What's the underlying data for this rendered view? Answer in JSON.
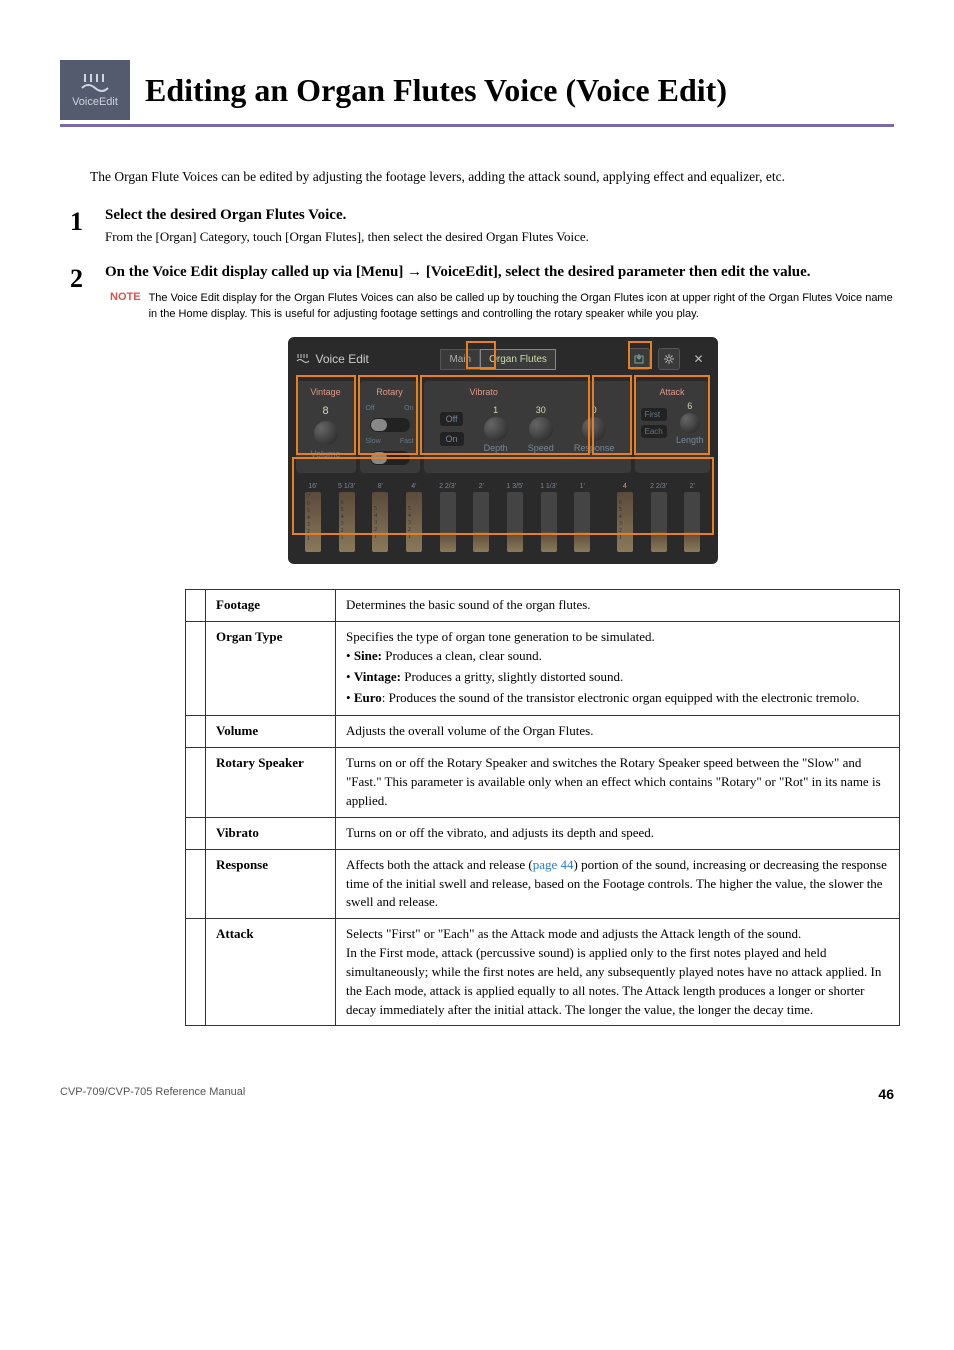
{
  "header": {
    "icon_label": "VoiceEdit",
    "title": "Editing an Organ Flutes Voice (Voice Edit)"
  },
  "intro": "The Organ Flute Voices can be edited by adjusting the footage levers, adding the attack sound, applying effect and equalizer, etc.",
  "steps": [
    {
      "num": "1",
      "title": "Select the desired Organ Flutes Voice.",
      "desc": "From the [Organ] Category, touch [Organ Flutes], then select the desired Organ Flutes Voice."
    },
    {
      "num": "2",
      "title": "On the Voice Edit display called up via [Menu] → [VoiceEdit], select the desired parameter then edit the value.",
      "desc": ""
    }
  ],
  "note": {
    "label": "NOTE",
    "text": "The Voice Edit display for the Organ Flutes Voices can also be called up by touching the Organ Flutes icon at upper right of the Organ Flutes Voice name in the Home display. This is useful for adjusting footage settings and controlling the rotary speaker while you play."
  },
  "screenshot": {
    "header_title": "Voice Edit",
    "tab_main": "Main",
    "tab_voice": "Organ Flutes",
    "panels": {
      "organ_type": {
        "label": "Vintage",
        "value": "8",
        "volume_label": "Volume"
      },
      "rotary": {
        "label": "Rotary",
        "off": "Off",
        "on": "On",
        "slow": "Slow",
        "fast": "Fast"
      },
      "vibrato": {
        "label": "Vibrato",
        "off": "Off",
        "on": "On",
        "depth_label": "Depth",
        "depth_val": "1",
        "speed_label": "Speed",
        "speed_val": "30",
        "response_label": "Response",
        "response_val": "0"
      },
      "attack": {
        "label": "Attack",
        "first": "First",
        "each": "Each",
        "length_label": "Length",
        "length_val": "6",
        "four_val": "4"
      }
    },
    "footage_labels": [
      "16'",
      "5 1/3'",
      "8'",
      "4'",
      "2 2/3'",
      "2'",
      "1 3/5'",
      "1 1/3'",
      "1'",
      "4'",
      "2 2/3'",
      "2'"
    ]
  },
  "table": [
    {
      "label": "Footage",
      "body": "Determines the basic sound of the organ flutes."
    },
    {
      "label": "Organ Type",
      "body_intro": "Specifies the type of organ tone generation to be simulated.",
      "bullets": [
        {
          "strong": "Sine:",
          "rest": " Produces a clean, clear sound."
        },
        {
          "strong": "Vintage:",
          "rest": " Produces a gritty, slightly distorted sound."
        },
        {
          "strong": "Euro",
          "rest": ": Produces the sound of the transistor electronic organ equipped with the electronic tremolo."
        }
      ]
    },
    {
      "label": "Volume",
      "body": "Adjusts the overall volume of the Organ Flutes."
    },
    {
      "label": "Rotary Speaker",
      "body": "Turns on or off the Rotary Speaker and switches the Rotary Speaker speed between the \"Slow\" and \"Fast.\" This parameter is available only when an effect which contains \"Rotary\" or \"Rot\" in its name is applied."
    },
    {
      "label": "Vibrato",
      "body": "Turns on or off the vibrato, and adjusts its depth and speed."
    },
    {
      "label": "Response",
      "body_pre": "Affects both the attack and release (",
      "link": "page 44",
      "body_post": ") portion of the sound, increasing or decreasing the response time of the initial swell and release, based on the Footage controls. The higher the value, the slower the swell and release."
    },
    {
      "label": "Attack",
      "body": "Selects \"First\" or \"Each\" as the Attack mode and adjusts the Attack length of the sound.\nIn the First mode, attack (percussive sound) is applied only to the first notes played and held simultaneously; while the first notes are held, any subsequently played notes have no attack applied. In the Each mode, attack is applied equally to all notes. The Attack length produces a longer or shorter decay immediately after the initial attack. The longer the value, the longer the decay time."
    }
  ],
  "footer": {
    "left": "CVP-709/CVP-705 Reference Manual",
    "right": "46"
  }
}
